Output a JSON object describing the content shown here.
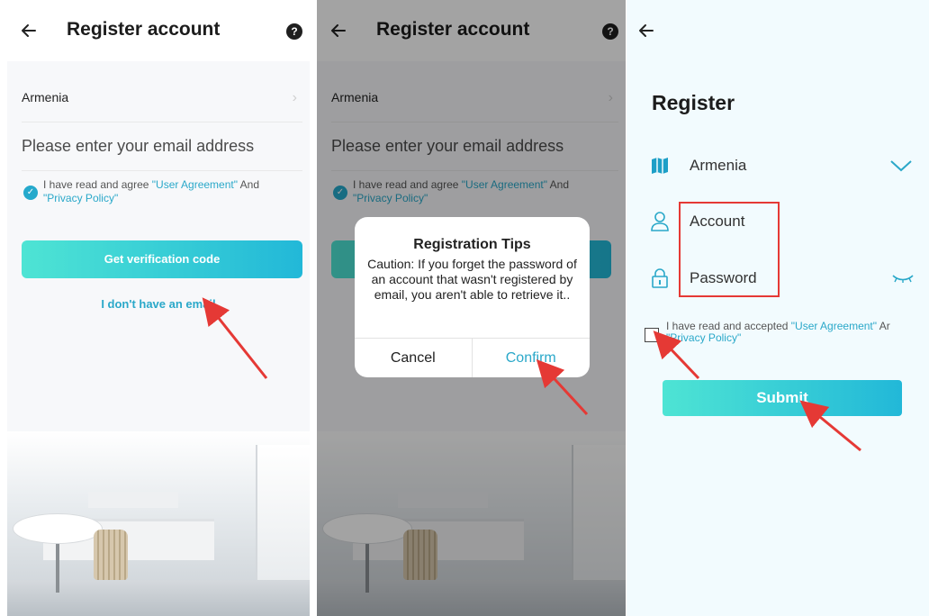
{
  "screen1": {
    "title": "Register account",
    "help_icon": "?",
    "country": "Armenia",
    "email_placeholder": "Please enter your email address",
    "agree_prefix": "I have read and agree ",
    "user_agreement": "\"User Agreement\"",
    "and_text": " And",
    "privacy_policy": "\"Privacy Policy\"",
    "get_code_button": "Get verification code",
    "no_email_link": "I don't have an email"
  },
  "screen2": {
    "title": "Register account",
    "help_icon": "?",
    "country": "Armenia",
    "email_placeholder": "Please enter your email address",
    "agree_prefix": "I have read and agree ",
    "user_agreement": "\"User Agreement\"",
    "and_text": " And",
    "privacy_policy": "\"Privacy Policy\"",
    "dialog": {
      "title": "Registration Tips",
      "body": "Caution: If you forget the password of an account that wasn't registered by email, you aren't able to retrieve it..",
      "cancel": "Cancel",
      "confirm": "Confirm"
    }
  },
  "screen3": {
    "title": "Register",
    "country": "Armenia",
    "account_placeholder": "Account",
    "password_placeholder": "Password",
    "agree_prefix": "I have read and accepted ",
    "user_agreement": "\"User Agreement\"",
    "and_text": " Ar",
    "privacy_policy": "\"Privacy Policy\"",
    "submit_button": "Submit"
  },
  "colors": {
    "accent": "#2aa8c9",
    "gradient_start": "#4ee4d4",
    "gradient_end": "#22b8d8",
    "annotation_red": "#e53935"
  },
  "icons": [
    "back-arrow-icon",
    "help-icon",
    "chevron-right-icon",
    "check-circle-icon",
    "map-icon",
    "user-icon",
    "lock-icon",
    "chevron-down-icon",
    "eye-closed-icon"
  ]
}
